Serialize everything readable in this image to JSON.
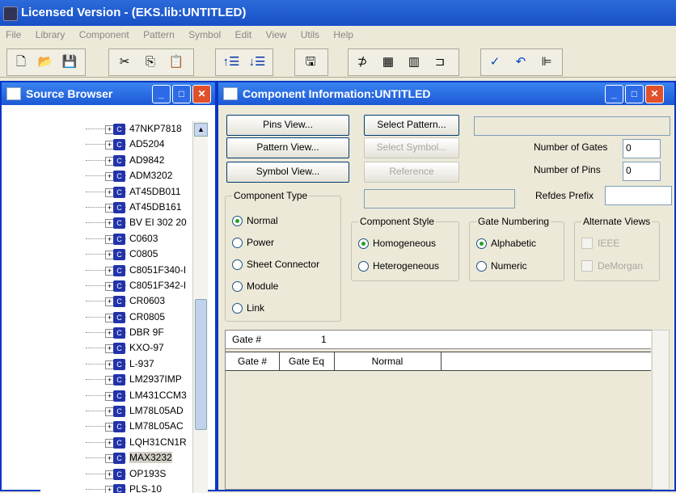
{
  "app": {
    "title": "Licensed Version - (EKS.lib:UNTITLED)"
  },
  "menu": [
    "File",
    "Library",
    "Component",
    "Pattern",
    "Symbol",
    "Edit",
    "View",
    "Utils",
    "Help"
  ],
  "toolbar_icons": [
    "new-file-icon",
    "open-folder-icon",
    "save-icon",
    "cut-icon",
    "copy-icon",
    "paste-icon",
    "insert-row-icon",
    "delete-row-icon",
    "component-icon",
    "pin-icon",
    "grid-icon",
    "package-icon",
    "gate-icon",
    "check-icon",
    "undo-icon",
    "tree-icon"
  ],
  "source_browser": {
    "title": "Source Browser",
    "items": [
      "47NKP7818",
      "AD5204",
      "AD9842",
      "ADM3202",
      "AT45DB011",
      "AT45DB161",
      "BV EI 302 20",
      "C0603",
      "C0805",
      "C8051F340-I",
      "C8051F342-I",
      "CR0603",
      "CR0805",
      "DBR 9F",
      "KXO-97",
      "L-937",
      "LM2937IMP",
      "LM431CCM3",
      "LM78L05AD",
      "LM78L05AC",
      "LQH31CN1R",
      "MAX3232",
      "OP193S",
      "PLS-10"
    ],
    "selected_index": 21
  },
  "dialog": {
    "title": "Component Information:UNTITLED",
    "pins_view": "Pins View...",
    "pattern_view": "Pattern View...",
    "symbol_view": "Symbol View...",
    "select_pattern": "Select Pattern...",
    "select_symbol": "Select Symbol...",
    "reference": "Reference",
    "number_of_gates_label": "Number of Gates",
    "number_of_gates": "0",
    "number_of_pins_label": "Number of Pins",
    "number_of_pins": "0",
    "refdes_prefix_label": "Refdes Prefix",
    "refdes_prefix": "",
    "component_type": {
      "title": "Component Type",
      "options": [
        "Normal",
        "Power",
        "Sheet Connector",
        "Module",
        "Link"
      ],
      "selected": 0
    },
    "component_style": {
      "title": "Component Style",
      "options": [
        "Homogeneous",
        "Heterogeneous"
      ],
      "selected": 0
    },
    "gate_numbering": {
      "title": "Gate Numbering",
      "options": [
        "Alphabetic",
        "Numeric"
      ],
      "selected": 0
    },
    "alternate_views": {
      "title": "Alternate Views",
      "options": [
        "IEEE",
        "DeMorgan"
      ]
    },
    "gate_label": "Gate #",
    "gate_value": "1",
    "gate_columns": [
      "Gate #",
      "Gate Eq",
      "Normal"
    ]
  },
  "colors": {
    "title_blue": "#1c58d6",
    "face": "#ece9d8",
    "radio_green": "#21a121"
  }
}
